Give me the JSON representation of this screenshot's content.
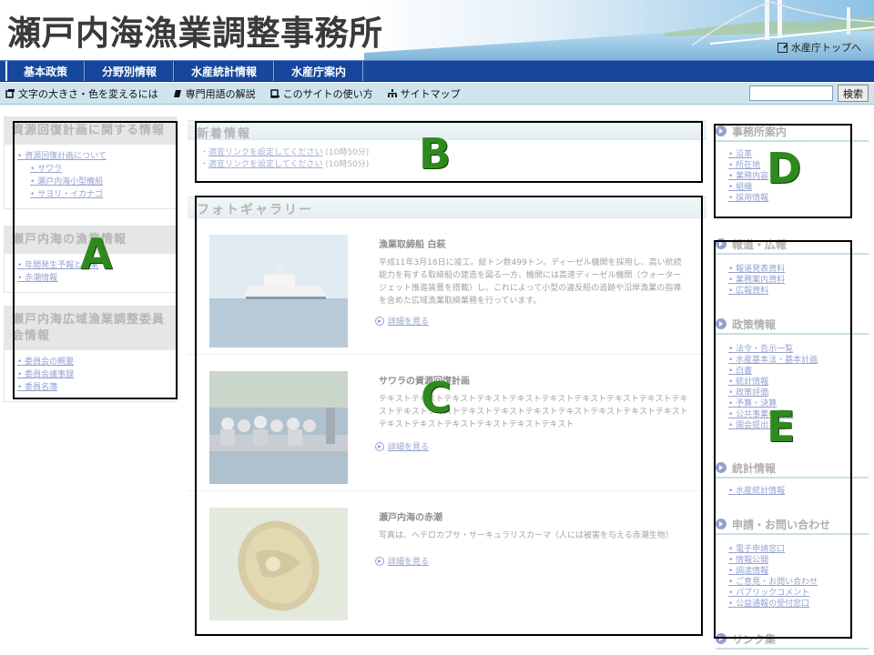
{
  "header": {
    "site_title": "瀬戸内海漁業調整事務所",
    "ministry_link": "水産庁トップへ"
  },
  "global_nav": [
    "基本政策",
    "分野別情報",
    "水産統計情報",
    "水産庁案内"
  ],
  "utility_bar": {
    "items": [
      "文字の大きさ・色を変えるには",
      "専門用語の解説",
      "このサイトの使い方",
      "サイトマップ"
    ],
    "search_button": "検索"
  },
  "left": {
    "box1": {
      "title": "資源回復計画に関する情報",
      "links": [
        {
          "text": "資源回復計画について",
          "level": 0
        },
        {
          "text": "サワラ",
          "level": 1
        },
        {
          "text": "瀬戸内海小型機船",
          "level": 1
        },
        {
          "text": "サヨリ・イカナゴ",
          "level": 1
        }
      ]
    },
    "box2": {
      "title": "瀬戸内海の漁業情報",
      "links": [
        {
          "text": "年間発生予報と結果",
          "level": 0
        },
        {
          "text": "赤潮情報",
          "level": 0
        }
      ]
    },
    "box3": {
      "title": "瀬戸内海広域漁業調整委員会情報",
      "links": [
        {
          "text": "委員会の概要",
          "level": 0
        },
        {
          "text": "委員会議事録",
          "level": 0
        },
        {
          "text": "委員名簿",
          "level": 0
        }
      ]
    }
  },
  "news": {
    "title": "新着情報",
    "items": [
      {
        "text": "適宜リンクを設定してください",
        "date": "(10時50分)"
      },
      {
        "text": "適宜リンクを設定してください",
        "date": "(10時50分)"
      }
    ]
  },
  "gallery": {
    "title": "フォトギャラリー",
    "entries": [
      {
        "title": "漁業取締船 白萩",
        "desc": "平成11年3月18日に竣工。総トン数499トン。ディーゼル機関を採用し、高い航続能力を有する取締船の建造を図る一方、機関には高速ディーゼル機関（ウォータージェット推進装置を搭載）し、これによって小型の違反船の追跡や沿岸漁業の指導を含めた広域漁業取締業務を行っています。",
        "more": "詳細を見る"
      },
      {
        "title": "サワラの資源回復計画",
        "desc": "テキストテキストテキストテキストテキストテキストテキストテキストテキストテキストテキストテキストテキストテキストテキストテキストテキストテキストテキストテキストテキストテキストテキストテキストテキスト",
        "more": "詳細を見る"
      },
      {
        "title": "瀬戸内海の赤潮",
        "desc": "写真は、ヘテロカプサ・サーキュラリスカーマ（人には被害を与える赤潮生物）",
        "more": "詳細を見る"
      }
    ]
  },
  "right": {
    "office": {
      "title": "事務所案内",
      "links": [
        "沿革",
        "所在地",
        "業務内容",
        "組織",
        "採用情報"
      ]
    },
    "press": {
      "title": "報道・広報",
      "links": [
        "報道発表資料",
        "業務案内資料",
        "広報資料"
      ]
    },
    "policy": {
      "title": "政策情報",
      "links": [
        "法令・告示一覧",
        "水産基本法・基本計画",
        "白書",
        "統計情報",
        "政策評価",
        "予算・決算",
        "公共事業の評価",
        "国会提出法案"
      ]
    },
    "stats": {
      "title": "統計情報",
      "links": [
        "水産統計情報"
      ]
    },
    "apply": {
      "title": "申請・お問い合わせ",
      "links": [
        "電子申請窓口",
        "情報公開",
        "調達情報",
        "ご意見・お問い合わせ",
        "パブリックコメント",
        "公益通報の受付窓口"
      ]
    },
    "links": {
      "title": "リンク集"
    }
  },
  "annotations": [
    "A",
    "B",
    "C",
    "D",
    "E"
  ]
}
